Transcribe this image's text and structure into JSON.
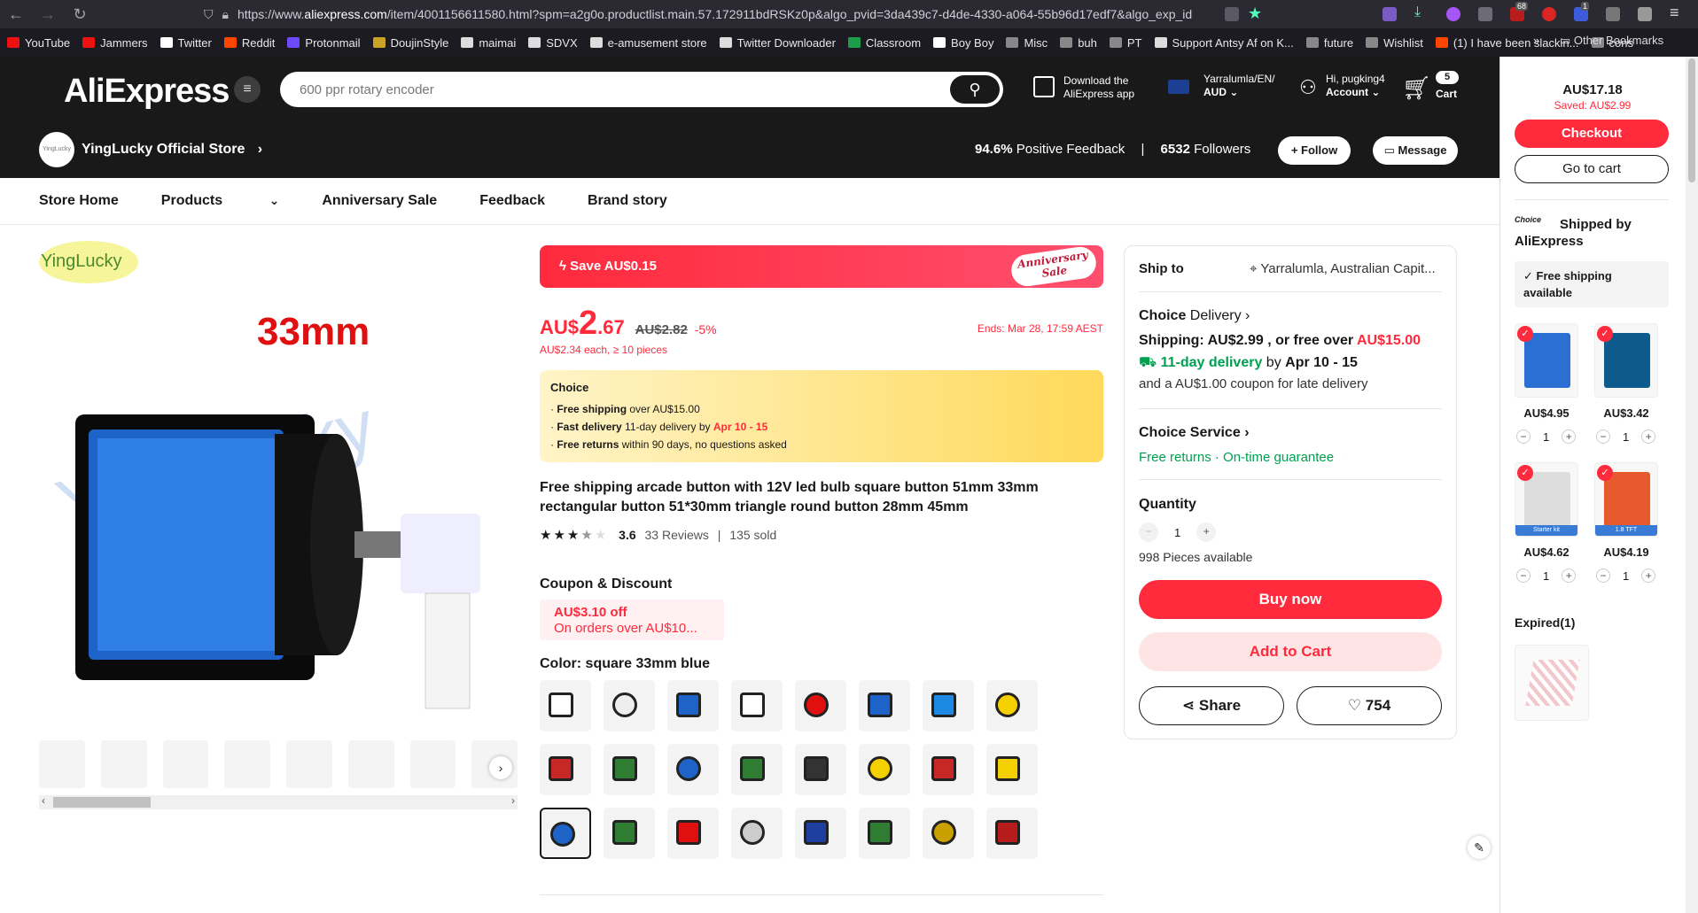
{
  "browser": {
    "url_prefix": "https://www.",
    "url_domain": "aliexpress.com",
    "url_rest": "/item/4001156611580.html?spm=a2g0o.productlist.main.57.172911bdRSKz0p&algo_pvid=3da439c7-d4de-4330-a064-55b96d17edf7&algo_exp_id",
    "bookmarks": [
      "YouTube",
      "Jammers",
      "Twitter",
      "Reddit",
      "Protonmail",
      "DoujinStyle",
      "maimai",
      "SDVX",
      "e-amusement store",
      "Twitter Downloader",
      "Classroom",
      "Boy Boy",
      "Misc",
      "buh",
      "PT",
      "Support Antsy Af on K...",
      "future",
      "Wishlist",
      "(1) I have been slackin...",
      "cons"
    ],
    "other_bookmarks": "Other Bookmarks",
    "ext_badge_1": "68",
    "ext_badge_2": "1"
  },
  "header": {
    "logo": "AliExpress",
    "search_placeholder": "600 ppr rotary encoder",
    "download_line1": "Download the",
    "download_line2": "AliExpress app",
    "locale_line1": "Yarralumla/EN/",
    "locale_line2": "AUD",
    "account_line1": "Hi, pugking4",
    "account_line2": "Account",
    "cart_count": "5",
    "cart_label": "Cart"
  },
  "store": {
    "avatar_text": "YingLucky",
    "name": "YingLucky Official Store",
    "feedback_value": "94.6%",
    "feedback_label": "Positive Feedback",
    "followers_value": "6532",
    "followers_label": "Followers",
    "follow_label": "+ Follow",
    "message_label": "Message"
  },
  "nav": [
    "Store Home",
    "Products",
    "Anniversary Sale",
    "Feedback",
    "Brand story"
  ],
  "gallery": {
    "brand": "YingLucky",
    "size_label": "33mm",
    "watermark": "YingLucky"
  },
  "product": {
    "save_text": "Save AU$0.15",
    "anniv_line1": "Anniversary",
    "anniv_line2": "Sale",
    "currency": "AU$",
    "price_int": "2",
    "price_dec": ".67",
    "orig_price": "AU$2.82",
    "discount": "-5%",
    "ends": "Ends: Mar 28, 17:59 AEST",
    "bulk": "AU$2.34 each, ≥ 10 pieces",
    "choice_title": "Choice",
    "choice_1_bold": "Free shipping",
    "choice_1_rest": " over AU$15.00",
    "choice_2_bold": "Fast delivery",
    "choice_2_rest": " 11-day delivery by ",
    "choice_2_red": "Apr 10 - 15",
    "choice_3_bold": "Free returns",
    "choice_3_rest": "  within 90 days, no questions asked",
    "title": "Free shipping arcade button with 12V led bulb square button 51mm 33mm rectangular button 51*30mm triangle round button 28mm 45mm",
    "rating": "3.6",
    "reviews": "33 Reviews",
    "sold": "135 sold",
    "rating_value": 3.6,
    "coupon_heading": "Coupon & Discount",
    "coupon_amount": "AU$3.10 off",
    "coupon_cond": "On orders over AU$10...",
    "color_heading": "Color: square 33mm blue",
    "selected_swatch": "16"
  },
  "ship": {
    "ship_to_label": "Ship to",
    "ship_to_value": "Yarralumla, Australian Capit...",
    "choice_delivery": "Choice",
    "delivery_word": "Delivery",
    "shipping_line": "Shipping: AU$2.99 , or free over ",
    "shipping_free": "AU$15.00",
    "days": "11-day delivery",
    "by": " by ",
    "dates": "Apr 10 - 15",
    "coupon_line": "and a AU$1.00 coupon for late delivery",
    "service_title": "Choice Service",
    "free_returns": "Free returns",
    "dot": " · ",
    "ontime": "On-time guarantee",
    "qty_label": "Quantity",
    "qty_minus": "−",
    "qty_value": "1",
    "qty_plus": "+",
    "available": "998 Pieces available",
    "buy_now": "Buy now",
    "add_cart": "Add to Cart",
    "share": "Share",
    "wish_count": "754"
  },
  "cart": {
    "total": "AU$17.18",
    "saved": "Saved: AU$2.99",
    "checkout": "Checkout",
    "go_to_cart": "Go to cart",
    "choice_badge": "Choice",
    "shipped_by_1": "Shipped by",
    "shipped_by_2": "AliExpress",
    "free_ship_1": "Free shipping",
    "free_ship_2": "available",
    "items": [
      {
        "price": "AU$4.95",
        "qty": "1"
      },
      {
        "price": "AU$3.42",
        "qty": "1"
      },
      {
        "price": "AU$4.62",
        "qty": "1"
      },
      {
        "price": "AU$4.19",
        "qty": "1"
      }
    ],
    "expired": "Expired(1)",
    "item3_label": "Starter kit",
    "item4_label": "1.8 TFT"
  },
  "colors": {
    "brand_red": "#ff2a3c",
    "green": "#00a050",
    "dark": "#191919"
  }
}
